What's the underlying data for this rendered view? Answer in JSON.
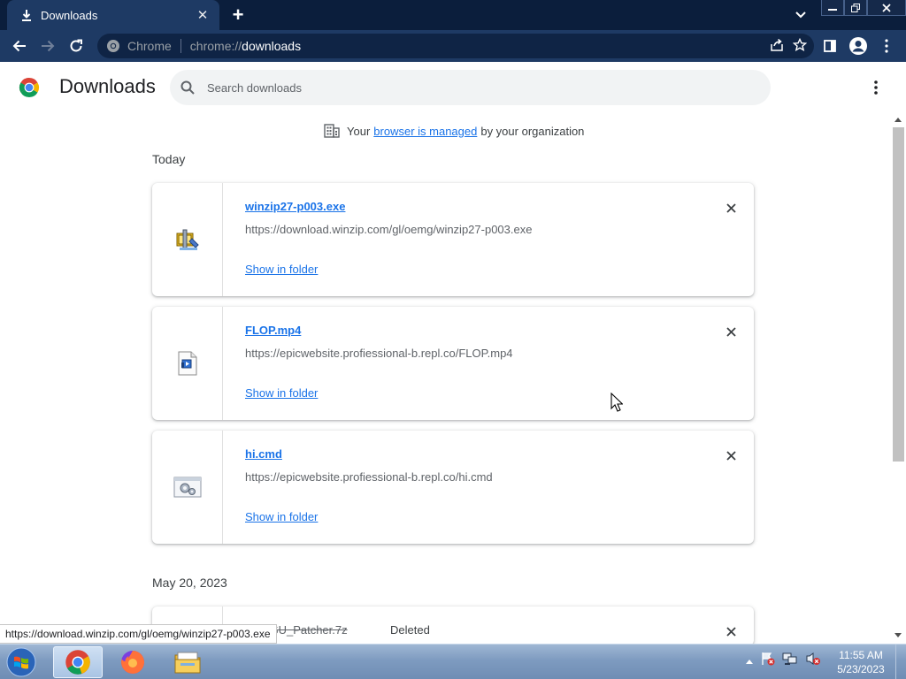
{
  "browser": {
    "tab_title": "Downloads",
    "omnibox_scheme": "Chrome",
    "omnibox_url_prefix": "chrome://",
    "omnibox_url_host": "downloads"
  },
  "page": {
    "title": "Downloads",
    "search_placeholder": "Search downloads",
    "managed_prefix": "Your",
    "managed_link": "browser is managed",
    "managed_suffix": "by your organization"
  },
  "sections": [
    {
      "label": "Today",
      "items": [
        {
          "filename": "winzip27-p003.exe",
          "url": "https://download.winzip.com/gl/oemg/winzip27-p003.exe",
          "action": "Show in folder",
          "icon": "winzip-installer-icon"
        },
        {
          "filename": "FLOP.mp4",
          "url": "https://epicwebsite.profiessional-b.repl.co/FLOP.mp4",
          "action": "Show in folder",
          "icon": "video-file-icon"
        },
        {
          "filename": "hi.cmd",
          "url": "https://epicwebsite.profiessional-b.repl.co/hi.cmd",
          "action": "Show in folder",
          "icon": "cmd-script-icon"
        }
      ]
    },
    {
      "label": "May 20, 2023",
      "items": [
        {
          "filename": "/U_ESU_Patcher.7z",
          "status": "Deleted"
        }
      ]
    }
  ],
  "status_bubble": "https://download.winzip.com/gl/oemg/winzip27-p003.exe",
  "taskbar": {
    "time": "11:55 AM",
    "date": "5/23/2023"
  },
  "colors": {
    "tabstrip": "#0b1e3c",
    "toolbar": "#1e3a64",
    "link": "#1a73e8"
  }
}
